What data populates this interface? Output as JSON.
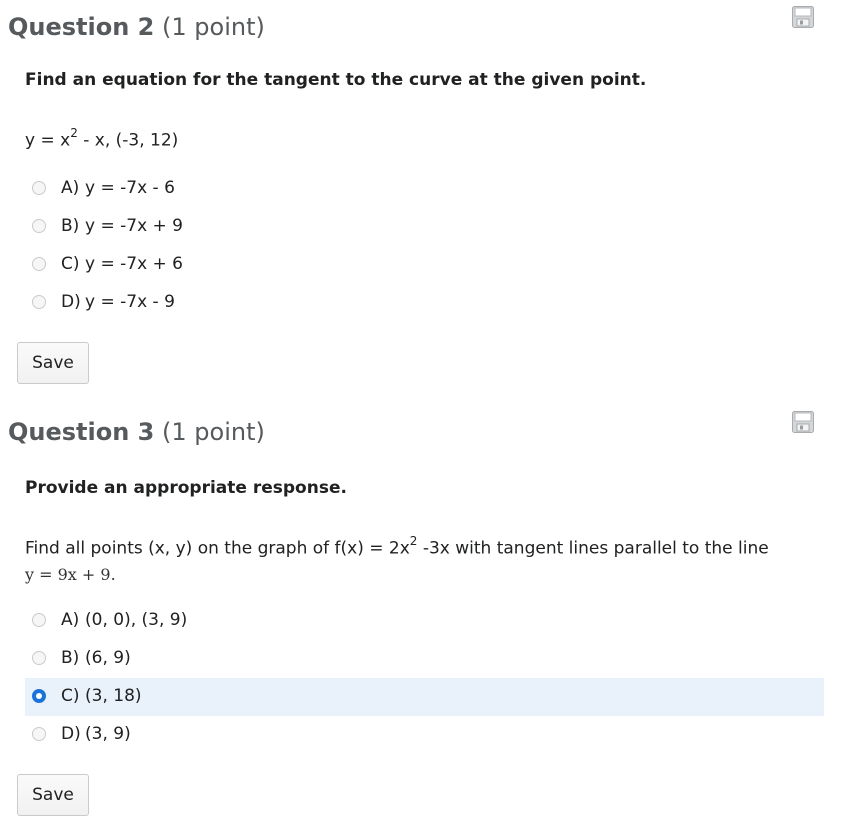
{
  "question2": {
    "title": "Question 2",
    "points": "(1 point)",
    "save_icon": "floppy-disk-icon",
    "instruction": "Find an equation for the tangent to the curve at the given point.",
    "prompt_pre": "y = x",
    "prompt_sup": "2",
    "prompt_post": " - x, (-3, 12)",
    "options": [
      {
        "letter": "A)",
        "text": "y = -7x - 6"
      },
      {
        "letter": "B)",
        "text": "y = -7x + 9"
      },
      {
        "letter": "C)",
        "text": "y = -7x + 6"
      },
      {
        "letter": "D)",
        "text": "y = -7x - 9"
      }
    ],
    "save_label": "Save"
  },
  "question3": {
    "title": "Question 3",
    "points": "(1 point)",
    "save_icon": "floppy-disk-icon",
    "instruction": "Provide an appropriate response.",
    "prompt_pre": "Find all points (x, y) on the graph of f(x) = 2x",
    "prompt_sup": "2",
    "prompt_post": " -3x with tangent lines parallel to the line",
    "prompt_equation": "y = 9x + 9.",
    "options": [
      {
        "letter": "A)",
        "text": "(0, 0), (3, 9)"
      },
      {
        "letter": "B)",
        "text": "(6, 9)"
      },
      {
        "letter": "C)",
        "text": "(3, 18)"
      },
      {
        "letter": "D)",
        "text": "(3, 9)"
      }
    ],
    "selected_option": "C)",
    "save_label": "Save"
  },
  "colors": {
    "selected_row_bg": "#e9f2fb",
    "radio_checked": "#1a73d9",
    "header_text": "#565a5c"
  }
}
